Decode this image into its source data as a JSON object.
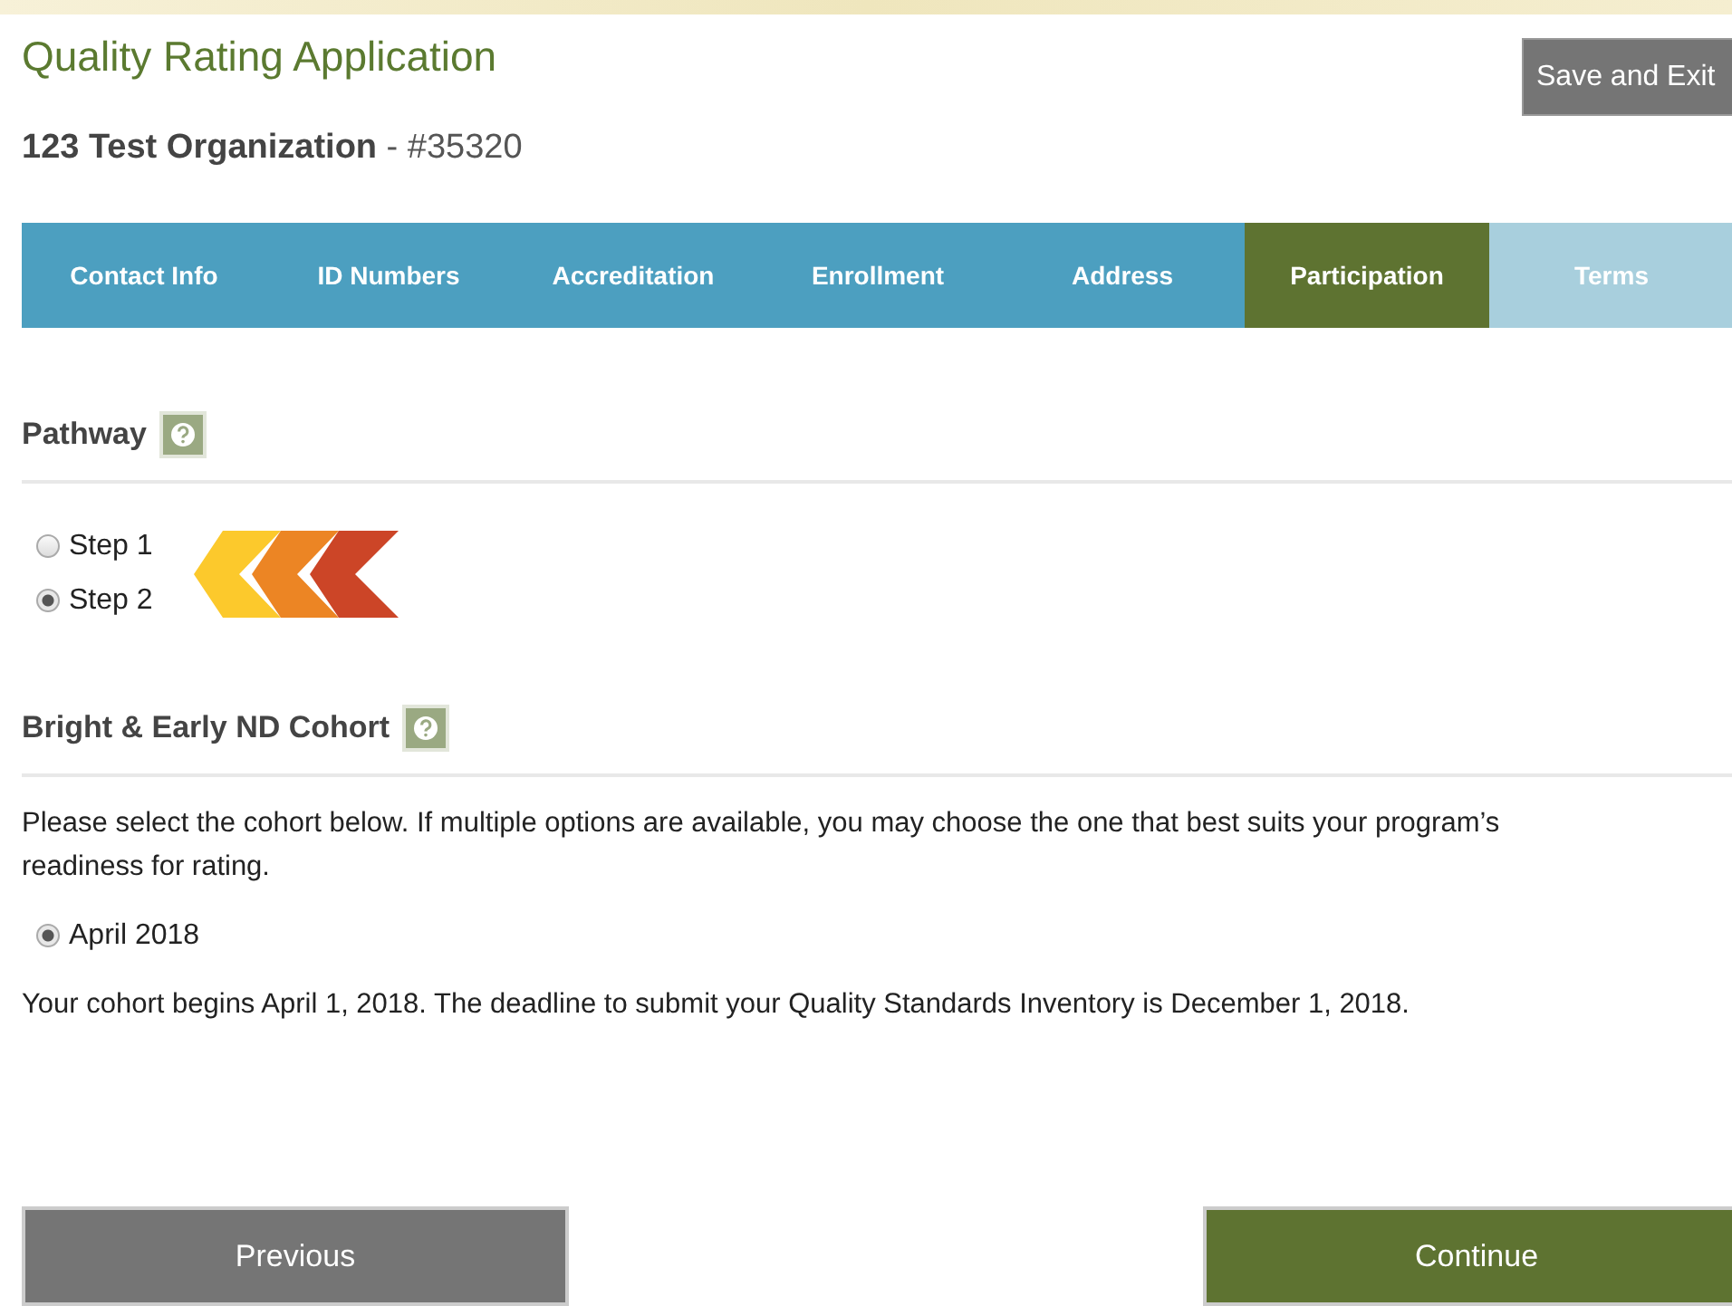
{
  "header": {
    "title": "Quality Rating Application",
    "organization": "123 Test Organization",
    "number": " - #35320",
    "save_button": "Save and Exit"
  },
  "tabs": [
    {
      "label": "Contact Info",
      "selected": false,
      "disabled": false
    },
    {
      "label": "ID Numbers",
      "selected": false,
      "disabled": false
    },
    {
      "label": "Accreditation",
      "selected": false,
      "disabled": false
    },
    {
      "label": "Enrollment",
      "selected": false,
      "disabled": false
    },
    {
      "label": "Address",
      "selected": false,
      "disabled": false
    },
    {
      "label": "Participation",
      "selected": true,
      "disabled": false
    },
    {
      "label": "Terms",
      "selected": false,
      "disabled": true
    }
  ],
  "pathway": {
    "heading": "Pathway",
    "options": [
      {
        "label": "Step 1",
        "selected": false
      },
      {
        "label": "Step 2",
        "selected": true
      }
    ]
  },
  "cohort": {
    "heading": "Bright & Early ND Cohort",
    "instructions": "Please select the cohort below. If multiple options are available, you may choose the one that best suits your program’s readiness for rating.",
    "options": [
      {
        "label": "April 2018",
        "selected": true
      }
    ],
    "note": "Your cohort begins April 1, 2018. The deadline to submit your Quality Standards Inventory is December 1, 2018."
  },
  "footer": {
    "previous": "Previous",
    "continue": "Continue"
  }
}
